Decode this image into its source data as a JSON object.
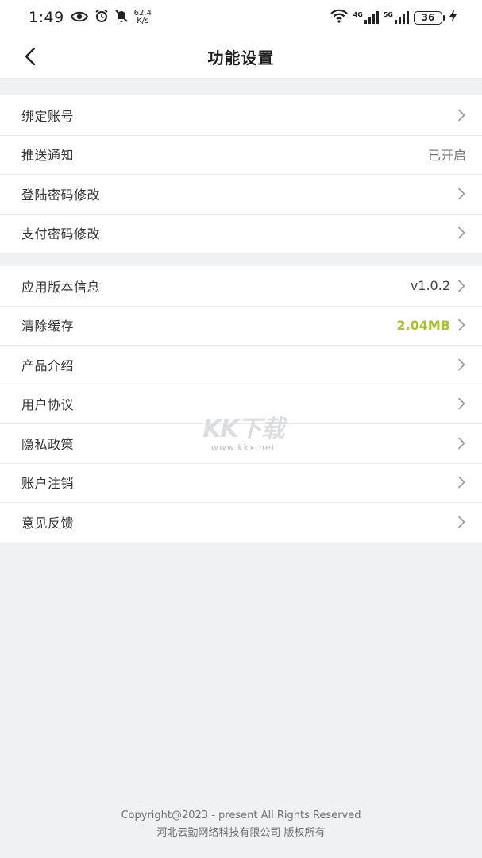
{
  "status_bar": {
    "time": "1:49",
    "net_speed_value": "62.4",
    "net_speed_unit": "K/s",
    "net_4g_label": "4G",
    "net_5g_label": "5G",
    "battery_level": "36",
    "icons": [
      "eye-icon",
      "alarm-icon",
      "mute-icon",
      "wifi-icon",
      "signal-icon",
      "charging-icon"
    ]
  },
  "header": {
    "title": "功能设置"
  },
  "groups": [
    {
      "items": [
        {
          "label": "绑定账号",
          "value": "",
          "chevron": true
        },
        {
          "label": "推送通知",
          "value": "已开启",
          "chevron": false
        },
        {
          "label": "登陆密码修改",
          "value": "",
          "chevron": true
        },
        {
          "label": "支付密码修改",
          "value": "",
          "chevron": true
        }
      ]
    },
    {
      "items": [
        {
          "label": "应用版本信息",
          "value": "v1.0.2",
          "chevron": true
        },
        {
          "label": "清除缓存",
          "value": "2.04MB",
          "chevron": true
        },
        {
          "label": "产品介绍",
          "value": "",
          "chevron": true
        },
        {
          "label": "用户协议",
          "value": "",
          "chevron": true
        },
        {
          "label": "隐私政策",
          "value": "",
          "chevron": true
        },
        {
          "label": "账户注销",
          "value": "",
          "chevron": true
        },
        {
          "label": "意见反馈",
          "value": "",
          "chevron": true
        }
      ]
    }
  ],
  "watermark": {
    "main": "KK下载",
    "sub": "www.kkx.net"
  },
  "footer": {
    "line1": "Copyright@2023 - present All Rights Reserved",
    "line2": "河北云勤网络科技有限公司 版权所有"
  },
  "colors": {
    "accent": "#a9c12a",
    "background": "#f0f1f5"
  }
}
